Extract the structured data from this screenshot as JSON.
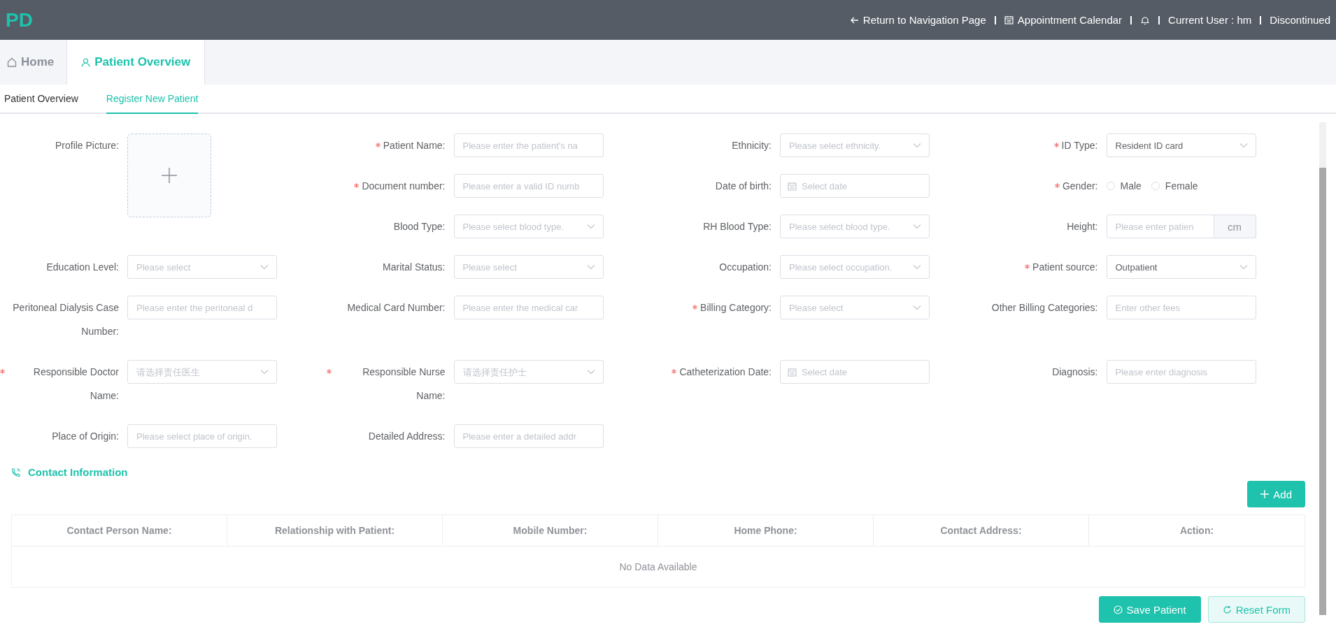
{
  "header": {
    "logo": "PD",
    "back_link": "Return to Navigation Page",
    "calendar_link": "Appointment Calendar",
    "current_user": "Current User : hm",
    "status": "Discontinued"
  },
  "tabs": [
    {
      "label": "Home",
      "selected": false
    },
    {
      "label": "Patient Overview",
      "selected": true
    }
  ],
  "subtabs": [
    {
      "label": "Patient Overview",
      "selected": false
    },
    {
      "label": "Register New Patient",
      "selected": true
    }
  ],
  "form": {
    "fields": [
      {
        "kind": "upload",
        "label": "Profile Picture:",
        "required": false
      },
      {
        "kind": "input",
        "label": "Patient Name:",
        "required": true,
        "placeholder": "Please enter the patient's na"
      },
      {
        "kind": "select",
        "label": "Ethnicity:",
        "required": false,
        "placeholder": "Please select ethnicity."
      },
      {
        "kind": "select",
        "label": "ID Type:",
        "required": true,
        "value": "Resident ID card"
      },
      {
        "kind": "input",
        "label": "Document number:",
        "required": true,
        "placeholder": "Please enter a valid ID numb"
      },
      {
        "kind": "date",
        "label": "Date of birth:",
        "required": false,
        "placeholder": "Select date"
      },
      {
        "kind": "radio",
        "label": "Gender:",
        "required": true,
        "options": [
          {
            "label": "Male",
            "selected": false
          },
          {
            "label": "Female",
            "selected": false
          }
        ]
      },
      {
        "kind": "select",
        "label": "Blood Type:",
        "required": false,
        "placeholder": "Please select blood type."
      },
      {
        "kind": "select",
        "label": "RH Blood Type:",
        "required": false,
        "placeholder": "Please select blood type."
      },
      {
        "kind": "unit",
        "label": "Height:",
        "required": false,
        "placeholder": "Please enter patien",
        "unit": "cm"
      },
      {
        "kind": "select",
        "label": "Education Level:",
        "required": false,
        "placeholder": "Please select"
      },
      {
        "kind": "select",
        "label": "Marital Status:",
        "required": false,
        "placeholder": "Please select"
      },
      {
        "kind": "select",
        "label": "Occupation:",
        "required": false,
        "placeholder": "Please select occupation."
      },
      {
        "kind": "select",
        "label": "Patient source:",
        "required": true,
        "value": "Outpatient"
      },
      {
        "kind": "input",
        "label": "Peritoneal Dialysis Case Number:",
        "required": false,
        "placeholder": "Please enter the peritoneal d"
      },
      {
        "kind": "input",
        "label": "Medical Card Number:",
        "required": false,
        "placeholder": "Please enter the medical car"
      },
      {
        "kind": "select",
        "label": "Billing Category:",
        "required": true,
        "placeholder": "Please select"
      },
      {
        "kind": "input",
        "label": "Other Billing Categories:",
        "required": false,
        "placeholder": "Enter other fees"
      },
      {
        "kind": "select",
        "label": "Responsible Doctor Name:",
        "required": true,
        "placeholder": "请选择责任医生"
      },
      {
        "kind": "select",
        "label": "Responsible Nurse Name:",
        "required": true,
        "placeholder": "请选择责任护士"
      },
      {
        "kind": "date",
        "label": "Catheterization Date:",
        "required": true,
        "placeholder": "Select date"
      },
      {
        "kind": "input",
        "label": "Diagnosis:",
        "required": false,
        "placeholder": "Please enter diagnosis"
      },
      {
        "kind": "input",
        "label": "Place of Origin:",
        "required": false,
        "placeholder": "Please select place of origin."
      },
      {
        "kind": "input",
        "label": "Detailed Address:",
        "required": false,
        "placeholder": "Please enter a detailed addr"
      }
    ]
  },
  "contacts": {
    "title": "Contact Information",
    "add_button": "Add",
    "columns": [
      "Contact Person Name:",
      "Relationship with Patient:",
      "Mobile Number:",
      "Home Phone:",
      "Contact Address:",
      "Action:"
    ],
    "empty_text": "No Data Available"
  },
  "actions": {
    "save": "Save Patient",
    "reset": "Reset Form"
  }
}
